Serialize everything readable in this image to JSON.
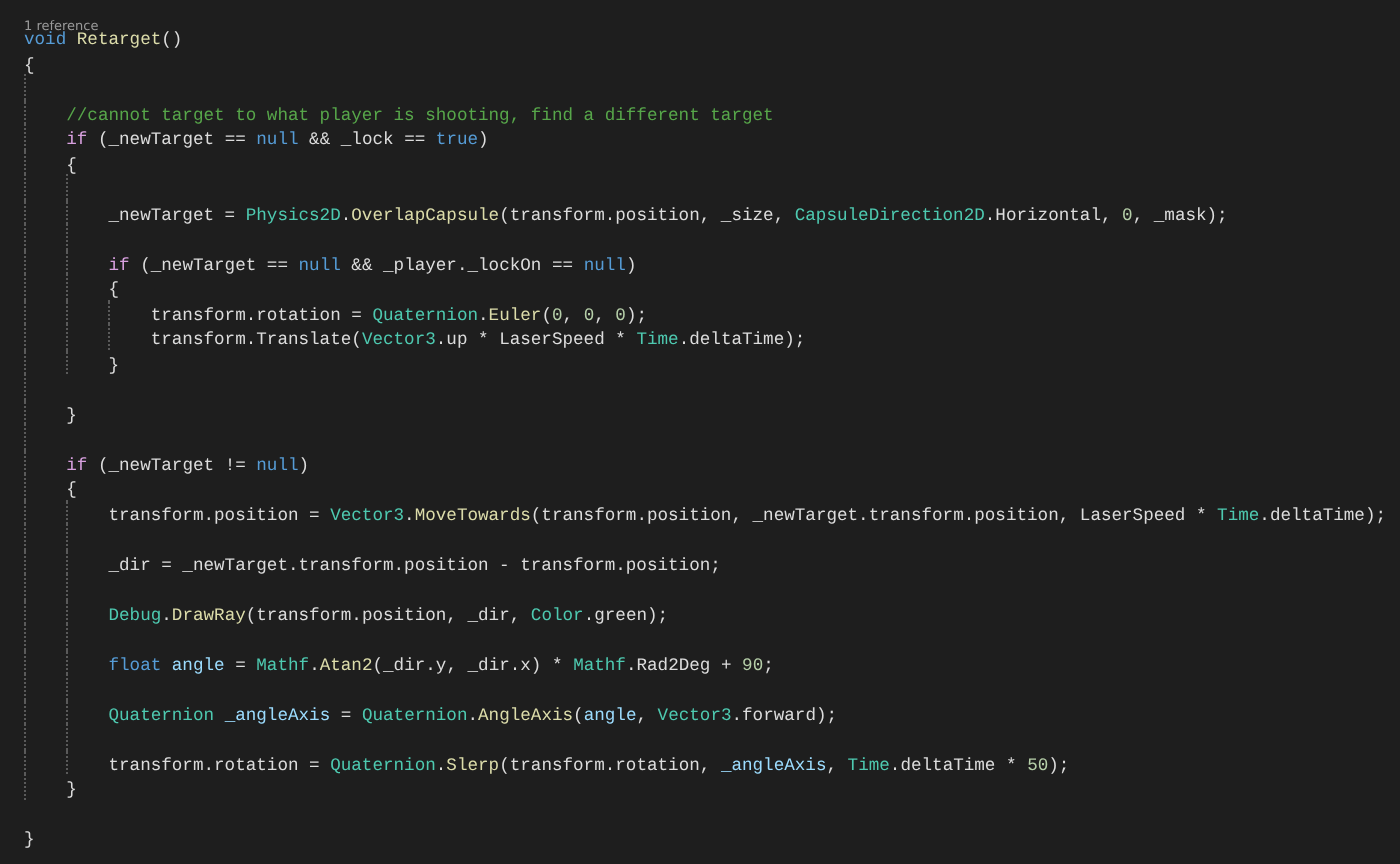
{
  "codelens": {
    "text": "1 reference"
  },
  "lines": [
    {
      "kind": "code",
      "tokens": [
        {
          "text": "void",
          "kind": "keyword"
        },
        {
          "text": " Retarget",
          "kind": "method"
        },
        {
          "text": "()",
          "kind": "plain"
        }
      ]
    },
    {
      "kind": "code",
      "tokens": [
        {
          "text": "{",
          "kind": "plain"
        }
      ]
    },
    {
      "kind": "blank"
    },
    {
      "kind": "code",
      "tokens": [
        {
          "text": "    //cannot target to what player is shooting, find a different target",
          "kind": "comment"
        }
      ]
    },
    {
      "kind": "code",
      "tokens": [
        {
          "text": "    if",
          "kind": "control"
        },
        {
          "text": " (_newTarget == ",
          "kind": "plain"
        },
        {
          "text": "null",
          "kind": "keyword"
        },
        {
          "text": " && _lock == ",
          "kind": "plain"
        },
        {
          "text": "true",
          "kind": "keyword"
        },
        {
          "text": ")",
          "kind": "plain"
        }
      ]
    },
    {
      "kind": "code",
      "tokens": [
        {
          "text": "    {",
          "kind": "plain"
        }
      ]
    },
    {
      "kind": "blank"
    },
    {
      "kind": "code",
      "tokens": [
        {
          "text": "        _newTarget = ",
          "kind": "plain"
        },
        {
          "text": "Physics2D",
          "kind": "type"
        },
        {
          "text": ".",
          "kind": "plain"
        },
        {
          "text": "OverlapCapsule",
          "kind": "method"
        },
        {
          "text": "(transform.position, _size, ",
          "kind": "plain"
        },
        {
          "text": "CapsuleDirection2D",
          "kind": "type"
        },
        {
          "text": ".Horizontal, ",
          "kind": "plain"
        },
        {
          "text": "0",
          "kind": "number"
        },
        {
          "text": ", _mask);",
          "kind": "plain"
        }
      ]
    },
    {
      "kind": "blank"
    },
    {
      "kind": "code",
      "tokens": [
        {
          "text": "        if",
          "kind": "control"
        },
        {
          "text": " (_newTarget == ",
          "kind": "plain"
        },
        {
          "text": "null",
          "kind": "keyword"
        },
        {
          "text": " && _player._lockOn == ",
          "kind": "plain"
        },
        {
          "text": "null",
          "kind": "keyword"
        },
        {
          "text": ")",
          "kind": "plain"
        }
      ]
    },
    {
      "kind": "code",
      "tokens": [
        {
          "text": "        {",
          "kind": "plain"
        }
      ]
    },
    {
      "kind": "code",
      "tokens": [
        {
          "text": "            transform.rotation = ",
          "kind": "plain"
        },
        {
          "text": "Quaternion",
          "kind": "type"
        },
        {
          "text": ".",
          "kind": "plain"
        },
        {
          "text": "Euler",
          "kind": "method"
        },
        {
          "text": "(",
          "kind": "plain"
        },
        {
          "text": "0",
          "kind": "number"
        },
        {
          "text": ", ",
          "kind": "plain"
        },
        {
          "text": "0",
          "kind": "number"
        },
        {
          "text": ", ",
          "kind": "plain"
        },
        {
          "text": "0",
          "kind": "number"
        },
        {
          "text": ");",
          "kind": "plain"
        }
      ]
    },
    {
      "kind": "code",
      "tokens": [
        {
          "text": "            transform.Translate(",
          "kind": "plain"
        },
        {
          "text": "Vector3",
          "kind": "type"
        },
        {
          "text": ".up * LaserSpeed * ",
          "kind": "plain"
        },
        {
          "text": "Time",
          "kind": "type"
        },
        {
          "text": ".deltaTime);",
          "kind": "plain"
        }
      ]
    },
    {
      "kind": "code",
      "tokens": [
        {
          "text": "        }",
          "kind": "plain"
        }
      ]
    },
    {
      "kind": "blank"
    },
    {
      "kind": "code",
      "tokens": [
        {
          "text": "    }",
          "kind": "plain"
        }
      ]
    },
    {
      "kind": "blank"
    },
    {
      "kind": "code",
      "tokens": [
        {
          "text": "    if",
          "kind": "control"
        },
        {
          "text": " (_newTarget != ",
          "kind": "plain"
        },
        {
          "text": "null",
          "kind": "keyword"
        },
        {
          "text": ")",
          "kind": "plain"
        }
      ]
    },
    {
      "kind": "code",
      "tokens": [
        {
          "text": "    {",
          "kind": "plain"
        }
      ]
    },
    {
      "kind": "code",
      "tokens": [
        {
          "text": "        transform.position = ",
          "kind": "plain"
        },
        {
          "text": "Vector3",
          "kind": "type"
        },
        {
          "text": ".",
          "kind": "plain"
        },
        {
          "text": "MoveTowards",
          "kind": "method"
        },
        {
          "text": "(transform.position, _newTarget.transform.position, LaserSpeed * ",
          "kind": "plain"
        },
        {
          "text": "Time",
          "kind": "type"
        },
        {
          "text": ".deltaTime);",
          "kind": "plain"
        }
      ]
    },
    {
      "kind": "blank"
    },
    {
      "kind": "code",
      "tokens": [
        {
          "text": "        _dir = _newTarget.transform.position - transform.position;",
          "kind": "plain"
        }
      ]
    },
    {
      "kind": "blank"
    },
    {
      "kind": "code",
      "tokens": [
        {
          "text": "        Debug",
          "kind": "type"
        },
        {
          "text": ".",
          "kind": "plain"
        },
        {
          "text": "DrawRay",
          "kind": "method"
        },
        {
          "text": "(transform.position, _dir, ",
          "kind": "plain"
        },
        {
          "text": "Color",
          "kind": "type"
        },
        {
          "text": ".green);",
          "kind": "plain"
        }
      ]
    },
    {
      "kind": "blank"
    },
    {
      "kind": "code",
      "tokens": [
        {
          "text": "        float ",
          "kind": "keyword"
        },
        {
          "text": "angle",
          "kind": "variable"
        },
        {
          "text": " = ",
          "kind": "plain"
        },
        {
          "text": "Mathf",
          "kind": "type"
        },
        {
          "text": ".",
          "kind": "plain"
        },
        {
          "text": "Atan2",
          "kind": "method"
        },
        {
          "text": "(_dir.y, _dir.x) * ",
          "kind": "plain"
        },
        {
          "text": "Mathf",
          "kind": "type"
        },
        {
          "text": ".Rad2Deg + ",
          "kind": "plain"
        },
        {
          "text": "90",
          "kind": "number"
        },
        {
          "text": ";",
          "kind": "plain"
        }
      ]
    },
    {
      "kind": "blank"
    },
    {
      "kind": "code",
      "tokens": [
        {
          "text": "        Quaternion ",
          "kind": "type"
        },
        {
          "text": "_angleAxis",
          "kind": "variable"
        },
        {
          "text": " = ",
          "kind": "plain"
        },
        {
          "text": "Quaternion",
          "kind": "type"
        },
        {
          "text": ".",
          "kind": "plain"
        },
        {
          "text": "AngleAxis",
          "kind": "method"
        },
        {
          "text": "(",
          "kind": "plain"
        },
        {
          "text": "angle",
          "kind": "variable"
        },
        {
          "text": ", ",
          "kind": "plain"
        },
        {
          "text": "Vector3",
          "kind": "type"
        },
        {
          "text": ".forward);",
          "kind": "plain"
        }
      ]
    },
    {
      "kind": "blank"
    },
    {
      "kind": "code",
      "tokens": [
        {
          "text": "        transform.rotation = ",
          "kind": "plain"
        },
        {
          "text": "Quaternion",
          "kind": "type"
        },
        {
          "text": ".",
          "kind": "plain"
        },
        {
          "text": "Slerp",
          "kind": "method"
        },
        {
          "text": "(transform.rotation, ",
          "kind": "plain"
        },
        {
          "text": "_angleAxis",
          "kind": "variable"
        },
        {
          "text": ", ",
          "kind": "plain"
        },
        {
          "text": "Time",
          "kind": "type"
        },
        {
          "text": ".deltaTime * ",
          "kind": "plain"
        },
        {
          "text": "50",
          "kind": "number"
        },
        {
          "text": ");",
          "kind": "plain"
        }
      ]
    },
    {
      "kind": "code",
      "tokens": [
        {
          "text": "    }",
          "kind": "plain"
        }
      ]
    },
    {
      "kind": "blank"
    },
    {
      "kind": "code",
      "tokens": [
        {
          "text": "}",
          "kind": "plain"
        }
      ]
    }
  ]
}
